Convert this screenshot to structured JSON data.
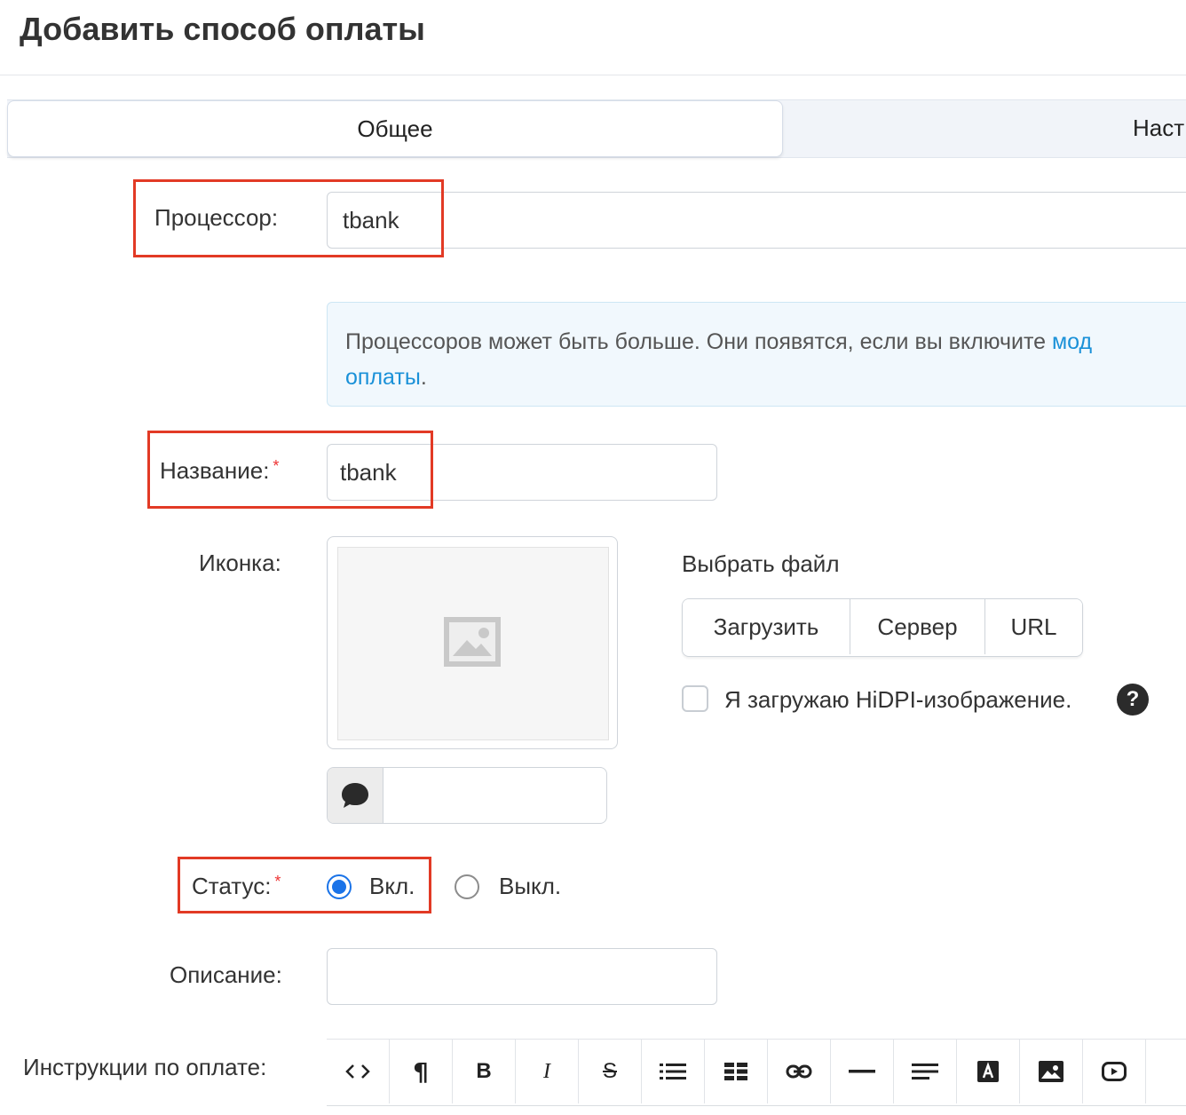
{
  "page": {
    "title": "Добавить способ оплаты"
  },
  "tabs": [
    {
      "label": "Общее",
      "active": true
    },
    {
      "label": "Наст",
      "active": false
    }
  ],
  "form": {
    "processor": {
      "label": "Процессор:",
      "value": "tbank"
    },
    "info": {
      "text": "Процессоров может быть больше. Они появятся, если вы включите ",
      "link_line1": "мод",
      "link_line2": "оплаты",
      "suffix": "."
    },
    "name": {
      "label": "Название:",
      "required_mark": "*",
      "value": "tbank"
    },
    "icon": {
      "label": "Иконка:",
      "choose_file_label": "Выбрать файл",
      "buttons": [
        "Загрузить",
        "Сервер",
        "URL"
      ],
      "hidpi_label": "Я загружаю HiDPI-изображение.",
      "hidpi_checked": false,
      "help_glyph": "?",
      "alt_input_value": ""
    },
    "status": {
      "label": "Статус:",
      "required_mark": "*",
      "options": [
        {
          "label": "Вкл.",
          "selected": true
        },
        {
          "label": "Выкл.",
          "selected": false
        }
      ]
    },
    "description": {
      "label": "Описание:",
      "value": ""
    },
    "instructions": {
      "label": "Инструкции по оплате:",
      "toolbar": [
        {
          "name": "code-view-icon",
          "glyph": "<>"
        },
        {
          "name": "paragraph-icon",
          "glyph": "¶"
        },
        {
          "name": "bold-icon",
          "glyph": "B"
        },
        {
          "name": "italic-icon",
          "glyph": "I"
        },
        {
          "name": "strikethrough-icon",
          "glyph": "S"
        },
        {
          "name": "bullet-list-icon",
          "glyph": ""
        },
        {
          "name": "table-icon",
          "glyph": ""
        },
        {
          "name": "link-icon",
          "glyph": ""
        },
        {
          "name": "horizontal-rule-icon",
          "glyph": ""
        },
        {
          "name": "align-icon",
          "glyph": ""
        },
        {
          "name": "font-color-icon",
          "glyph": "A"
        },
        {
          "name": "image-icon",
          "glyph": ""
        },
        {
          "name": "video-icon",
          "glyph": ""
        }
      ]
    }
  },
  "colors": {
    "highlight": "#e23a25",
    "accent": "#1a73e8",
    "link": "#1a91d8"
  }
}
